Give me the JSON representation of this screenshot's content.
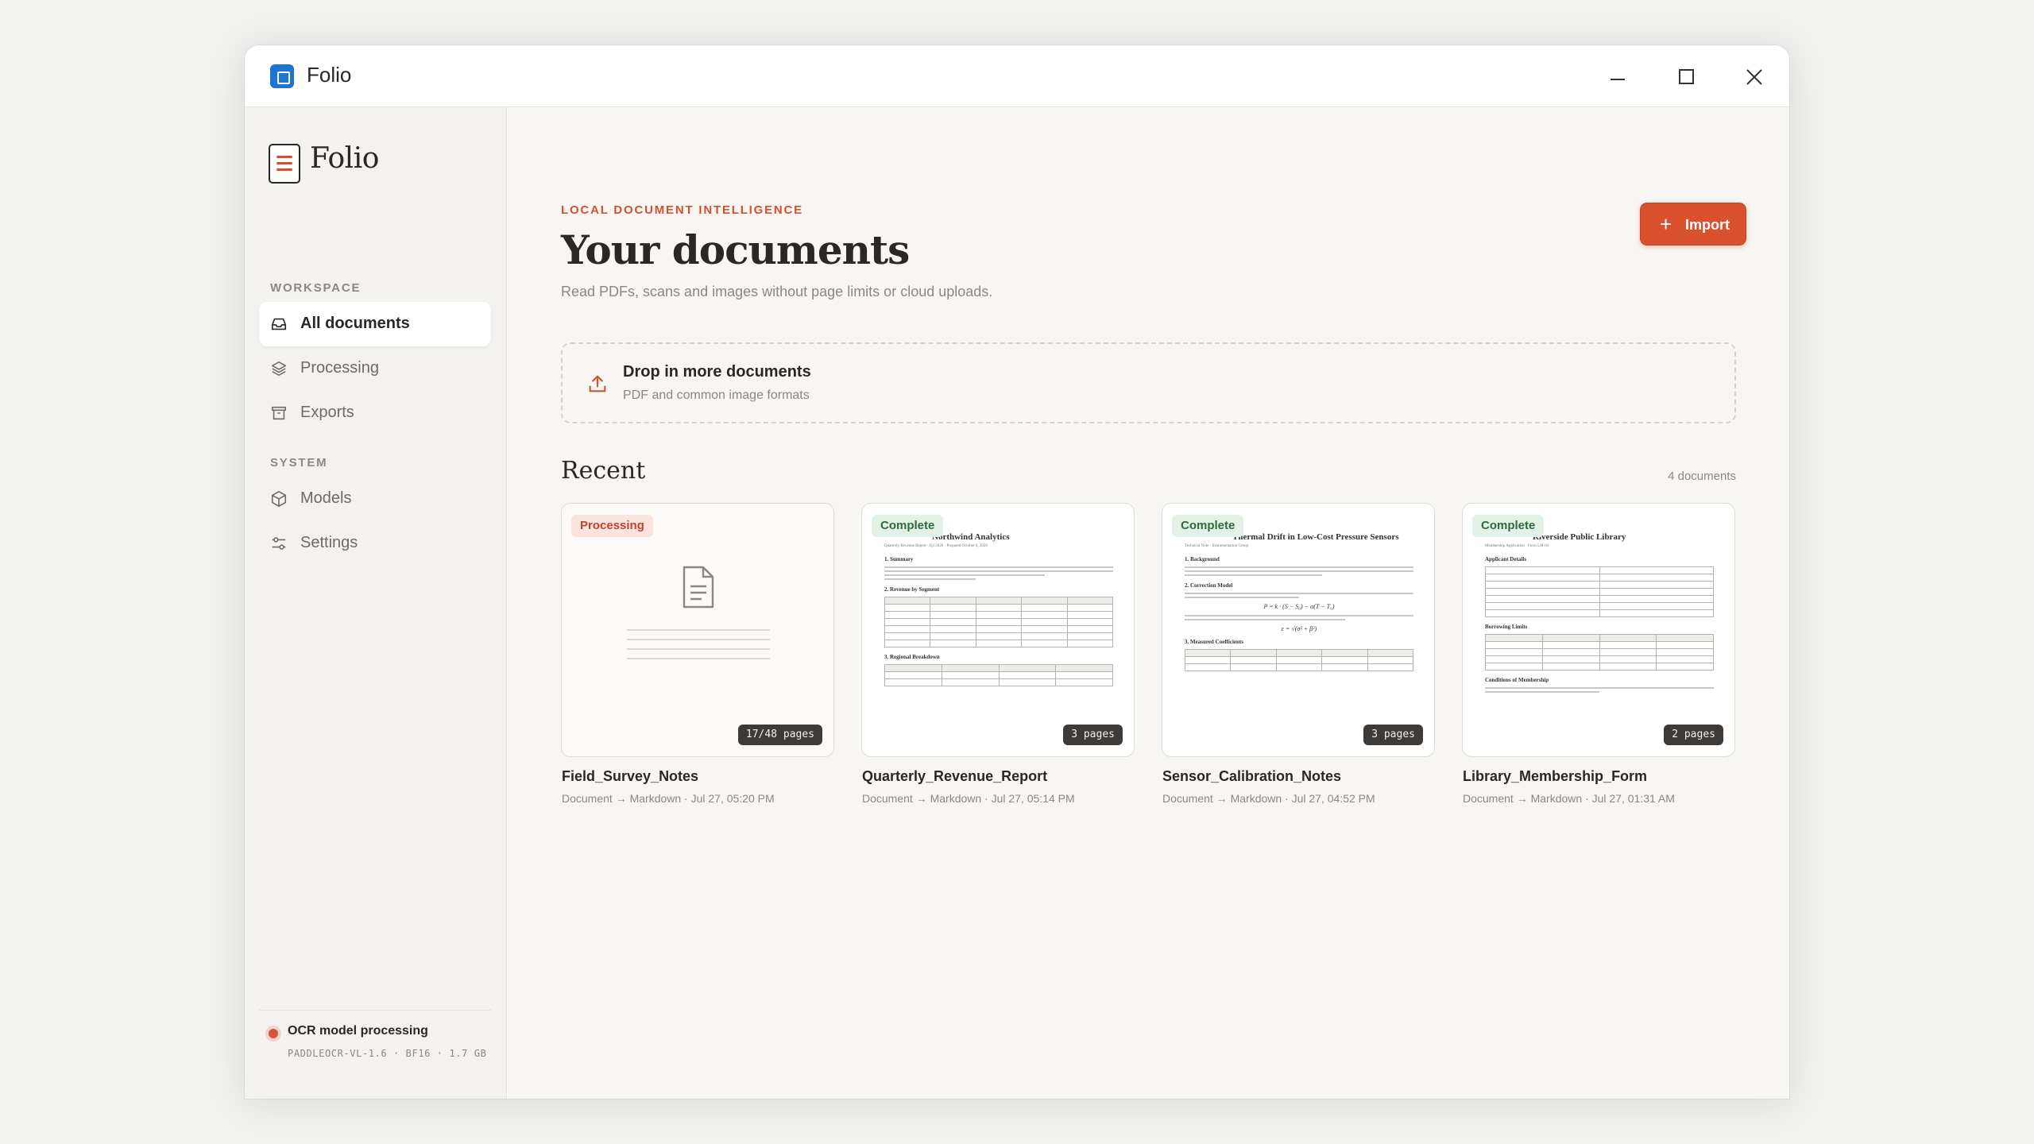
{
  "window": {
    "title": "Folio"
  },
  "sidebar": {
    "logo_text": "Folio",
    "sections": [
      {
        "label": "WORKSPACE"
      },
      {
        "label": "SYSTEM"
      }
    ],
    "items": [
      {
        "label": "All documents",
        "icon": "inbox-icon",
        "active": true
      },
      {
        "label": "Processing",
        "icon": "layers-icon"
      },
      {
        "label": "Exports",
        "icon": "archive-icon"
      },
      {
        "label": "Models",
        "icon": "cube-icon"
      },
      {
        "label": "Settings",
        "icon": "sliders-icon"
      }
    ],
    "status": {
      "label": "OCR model processing",
      "model": "PADDLEOCR-VL-1.6 · BF16 · 1.7 GB",
      "color": "#d9533a"
    }
  },
  "header": {
    "eyebrow": "LOCAL DOCUMENT INTELLIGENCE",
    "title": "Your documents",
    "subtitle": "Read PDFs, scans and images without page limits or cloud uploads.",
    "import_label": "Import",
    "accent": "#d9502c"
  },
  "dropzone": {
    "title": "Drop in more documents",
    "subtitle": "PDF and common image formats"
  },
  "recent": {
    "title": "Recent",
    "count": "4 documents",
    "documents": [
      {
        "name": "Field_Survey_Notes",
        "meta": "Document → Markdown · Jul 27, 05:20 PM",
        "status": "Processing",
        "pages": "17/48 pages"
      },
      {
        "name": "Quarterly_Revenue_Report",
        "meta": "Document → Markdown · Jul 27, 05:14 PM",
        "status": "Complete",
        "pages": "3 pages",
        "preview_title": "Northwind Analytics",
        "preview_sub": "Quarterly Revenue Report · Q3 2026 · Prepared October 6, 2026",
        "preview_h1": "1. Summary",
        "preview_h2": "2. Revenue by Segment",
        "preview_h3": "3. Regional Breakdown"
      },
      {
        "name": "Sensor_Calibration_Notes",
        "meta": "Document → Markdown · Jul 27, 04:52 PM",
        "status": "Complete",
        "pages": "3 pages",
        "preview_title": "Thermal Drift in Low-Cost Pressure Sensors",
        "preview_sub": "Technical Note · Instrumentation Group",
        "preview_h1": "1. Background",
        "preview_h2": "2. Correction Model",
        "preview_h3": "3. Measured Coefficients"
      },
      {
        "name": "Library_Membership_Form",
        "meta": "Document → Markdown · Jul 27, 01:31 AM",
        "status": "Complete",
        "pages": "2 pages",
        "preview_title": "Riverside Public Library",
        "preview_sub": "Membership Application · Form LM-04",
        "preview_h1": "Applicant Details",
        "preview_h2": "Borrowing Limits",
        "preview_h3": "Conditions of Membership"
      }
    ]
  }
}
